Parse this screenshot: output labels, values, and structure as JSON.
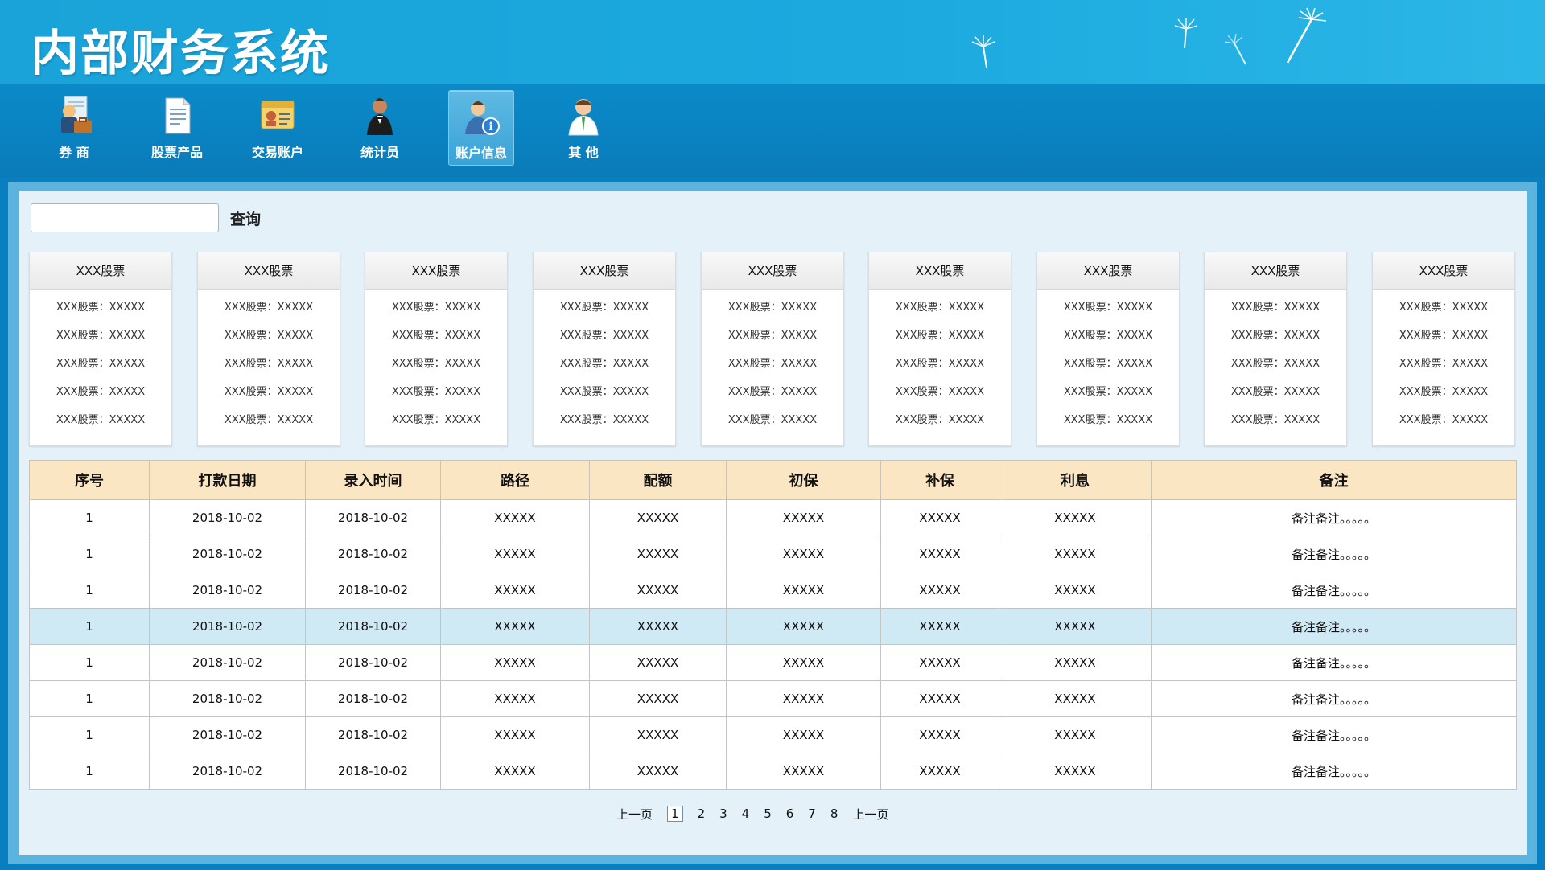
{
  "app": {
    "title": "内部财务系统"
  },
  "nav": [
    {
      "label": "券 商",
      "icon": "broker-icon"
    },
    {
      "label": "股票产品",
      "icon": "document-icon"
    },
    {
      "label": "交易账户",
      "icon": "id-card-icon"
    },
    {
      "label": "统计员",
      "icon": "statistician-icon"
    },
    {
      "label": "账户信息",
      "icon": "account-info-icon",
      "active": true
    },
    {
      "label": "其 他",
      "icon": "user-other-icon"
    }
  ],
  "search": {
    "value": "",
    "placeholder": "",
    "button": "查询"
  },
  "cards": [
    {
      "title": "XXX股票",
      "lines": [
        "XXX股票：XXXXX",
        "XXX股票：XXXXX",
        "XXX股票：XXXXX",
        "XXX股票：XXXXX",
        "XXX股票：XXXXX"
      ]
    },
    {
      "title": "XXX股票",
      "lines": [
        "XXX股票：XXXXX",
        "XXX股票：XXXXX",
        "XXX股票：XXXXX",
        "XXX股票：XXXXX",
        "XXX股票：XXXXX"
      ]
    },
    {
      "title": "XXX股票",
      "lines": [
        "XXX股票：XXXXX",
        "XXX股票：XXXXX",
        "XXX股票：XXXXX",
        "XXX股票：XXXXX",
        "XXX股票：XXXXX"
      ]
    },
    {
      "title": "XXX股票",
      "lines": [
        "XXX股票：XXXXX",
        "XXX股票：XXXXX",
        "XXX股票：XXXXX",
        "XXX股票：XXXXX",
        "XXX股票：XXXXX"
      ]
    },
    {
      "title": "XXX股票",
      "lines": [
        "XXX股票：XXXXX",
        "XXX股票：XXXXX",
        "XXX股票：XXXXX",
        "XXX股票：XXXXX",
        "XXX股票：XXXXX"
      ]
    },
    {
      "title": "XXX股票",
      "lines": [
        "XXX股票：XXXXX",
        "XXX股票：XXXXX",
        "XXX股票：XXXXX",
        "XXX股票：XXXXX",
        "XXX股票：XXXXX"
      ]
    },
    {
      "title": "XXX股票",
      "lines": [
        "XXX股票：XXXXX",
        "XXX股票：XXXXX",
        "XXX股票：XXXXX",
        "XXX股票：XXXXX",
        "XXX股票：XXXXX"
      ]
    },
    {
      "title": "XXX股票",
      "lines": [
        "XXX股票：XXXXX",
        "XXX股票：XXXXX",
        "XXX股票：XXXXX",
        "XXX股票：XXXXX",
        "XXX股票：XXXXX"
      ]
    },
    {
      "title": "XXX股票",
      "lines": [
        "XXX股票：XXXXX",
        "XXX股票：XXXXX",
        "XXX股票：XXXXX",
        "XXX股票：XXXXX",
        "XXX股票：XXXXX"
      ]
    }
  ],
  "table": {
    "headers": [
      "序号",
      "打款日期",
      "录入时间",
      "路径",
      "配额",
      "初保",
      "补保",
      "利息",
      "备注"
    ],
    "rows": [
      [
        "1",
        "2018-10-02",
        "2018-10-02",
        "XXXXX",
        "XXXXX",
        "XXXXX",
        "XXXXX",
        "XXXXX",
        "备注备注。。。。。"
      ],
      [
        "1",
        "2018-10-02",
        "2018-10-02",
        "XXXXX",
        "XXXXX",
        "XXXXX",
        "XXXXX",
        "XXXXX",
        "备注备注。。。。。"
      ],
      [
        "1",
        "2018-10-02",
        "2018-10-02",
        "XXXXX",
        "XXXXX",
        "XXXXX",
        "XXXXX",
        "XXXXX",
        "备注备注。。。。。"
      ],
      [
        "1",
        "2018-10-02",
        "2018-10-02",
        "XXXXX",
        "XXXXX",
        "XXXXX",
        "XXXXX",
        "XXXXX",
        "备注备注。。。。。"
      ],
      [
        "1",
        "2018-10-02",
        "2018-10-02",
        "XXXXX",
        "XXXXX",
        "XXXXX",
        "XXXXX",
        "XXXXX",
        "备注备注。。。。。"
      ],
      [
        "1",
        "2018-10-02",
        "2018-10-02",
        "XXXXX",
        "XXXXX",
        "XXXXX",
        "XXXXX",
        "XXXXX",
        "备注备注。。。。。"
      ],
      [
        "1",
        "2018-10-02",
        "2018-10-02",
        "XXXXX",
        "XXXXX",
        "XXXXX",
        "XXXXX",
        "XXXXX",
        "备注备注。。。。。"
      ],
      [
        "1",
        "2018-10-02",
        "2018-10-02",
        "XXXXX",
        "XXXXX",
        "XXXXX",
        "XXXXX",
        "XXXXX",
        "备注备注。。。。。"
      ]
    ],
    "highlighted_row": 3
  },
  "pagination": {
    "prev": "上一页",
    "pages": [
      "1",
      "2",
      "3",
      "4",
      "5",
      "6",
      "7",
      "8"
    ],
    "current": "1",
    "next": "上一页"
  },
  "colors": {
    "banner": "#1aa3d8",
    "navbar": "#0a80bf",
    "table_header": "#fbe6c3",
    "row_highlight": "#cfe9f5",
    "panel": "#e4f1f8"
  }
}
